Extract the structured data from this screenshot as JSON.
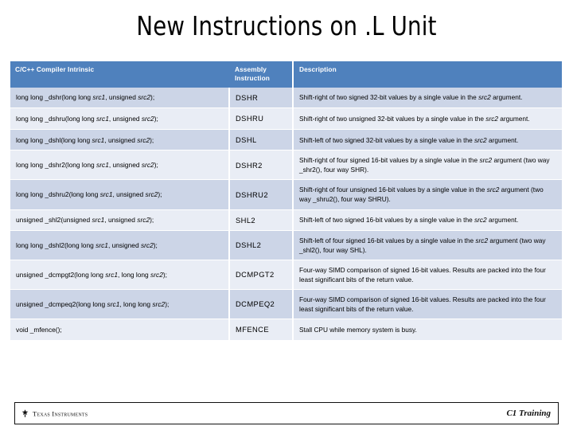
{
  "slide": {
    "title": "New Instructions on .L Unit"
  },
  "table": {
    "headers": {
      "intrinsic": "C/C++ Compiler Intrinsic",
      "assembly": "Assembly Instruction",
      "description": "Description"
    },
    "rows": [
      {
        "intrinsic": "long long _dshr(long long src1, unsigned src2);",
        "assembly": "DSHR",
        "description": "Shift-right of two signed 32-bit values by a single value in the src2 argument."
      },
      {
        "intrinsic": "long long _dshru(long long src1, unsigned src2);",
        "assembly": "DSHRU",
        "description": "Shift-right of two unsigned 32-bit values by a single value in the src2 argument."
      },
      {
        "intrinsic": "long long _dshl(long long src1, unsigned src2);",
        "assembly": "DSHL",
        "description": "Shift-left of two signed 32-bit values by a single value in the src2 argument."
      },
      {
        "intrinsic": "long long _dshr2(long long src1, unsigned src2);",
        "assembly": "DSHR2",
        "description": "Shift-right of four signed 16-bit values by a single value in the src2 argument (two way _shr2(), four way SHR)."
      },
      {
        "intrinsic": "long long _dshru2(long long src1, unsigned src2);",
        "assembly": "DSHRU2",
        "description": "Shift-right of four unsigned 16-bit values by a single value in the src2 argument (two way _shru2(), four way SHRU)."
      },
      {
        "intrinsic": "unsigned _shl2(unsigned src1, unsigned src2);",
        "assembly": "SHL2",
        "description": "Shift-left of two signed 16-bit values by a single value in the src2 argument."
      },
      {
        "intrinsic": "long long _dshl2(long long src1, unsigned src2);",
        "assembly": "DSHL2",
        "description": "Shift-left of four signed 16-bit values by a single value in the src2 argument (two way _shl2(), four way SHL)."
      },
      {
        "intrinsic": "unsigned _dcmpgt2(long long src1, long long src2);",
        "assembly": "DCMPGT2",
        "description": "Four-way SIMD comparison of signed 16-bit values. Results are packed into the four least significant bits of the return value."
      },
      {
        "intrinsic": "unsigned _dcmpeq2(long long src1, long long src2);",
        "assembly": "DCMPEQ2",
        "description": "Four-way SIMD comparison of signed 16-bit values. Results are packed into the four least significant bits of the return value."
      },
      {
        "intrinsic": "void _mfence();",
        "assembly": "MFENCE",
        "description": "Stall CPU while memory system is busy."
      }
    ]
  },
  "footer": {
    "company": "Texas Instruments",
    "course": "C1 Training"
  },
  "colors": {
    "header_blue": "#4f81bd",
    "band_dark": "#ccd5e7",
    "band_light": "#e9edf5",
    "text": "#000000"
  }
}
